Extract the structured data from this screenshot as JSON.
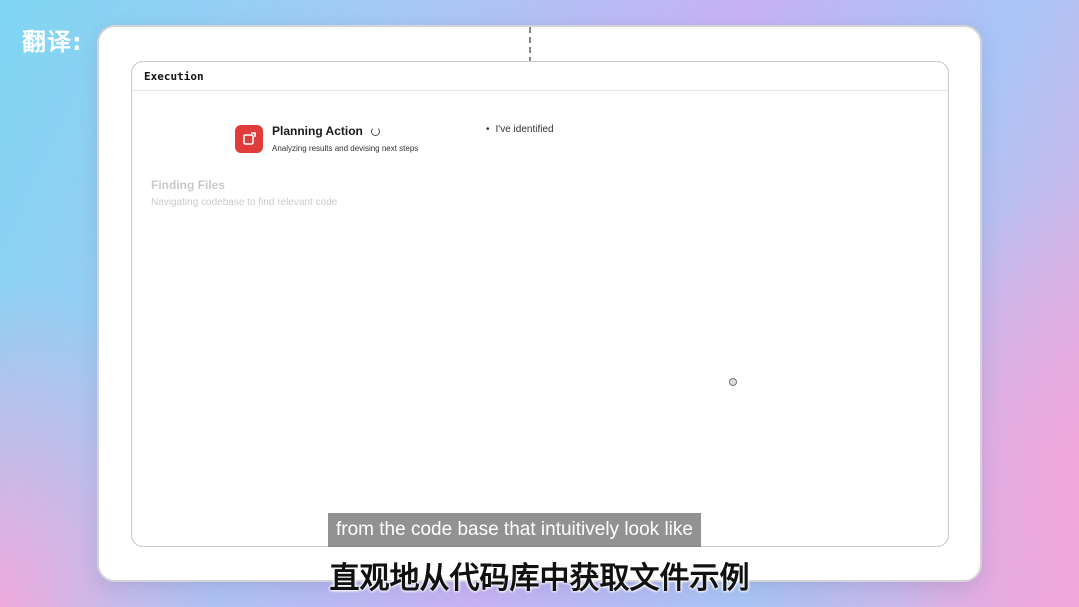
{
  "watermark": "翻译:",
  "panel": {
    "title": "Execution",
    "active_step": {
      "icon": "red-app-icon",
      "title": "Planning Action",
      "subtitle": "Analyzing results and devising next steps",
      "status_icon": "spinner-icon"
    },
    "bullet_text": "I've identified",
    "faded_step": {
      "title": "Finding Files",
      "subtitle": "Navigating codebase to find relevant code"
    }
  },
  "subtitles": {
    "english": "from the code base that intuitively look like",
    "chinese": "直观地从代码库中获取文件示例"
  },
  "colors": {
    "app_icon": "#e03c3c",
    "background_start": "#7fd6f2",
    "background_end": "#f1a9dd"
  }
}
